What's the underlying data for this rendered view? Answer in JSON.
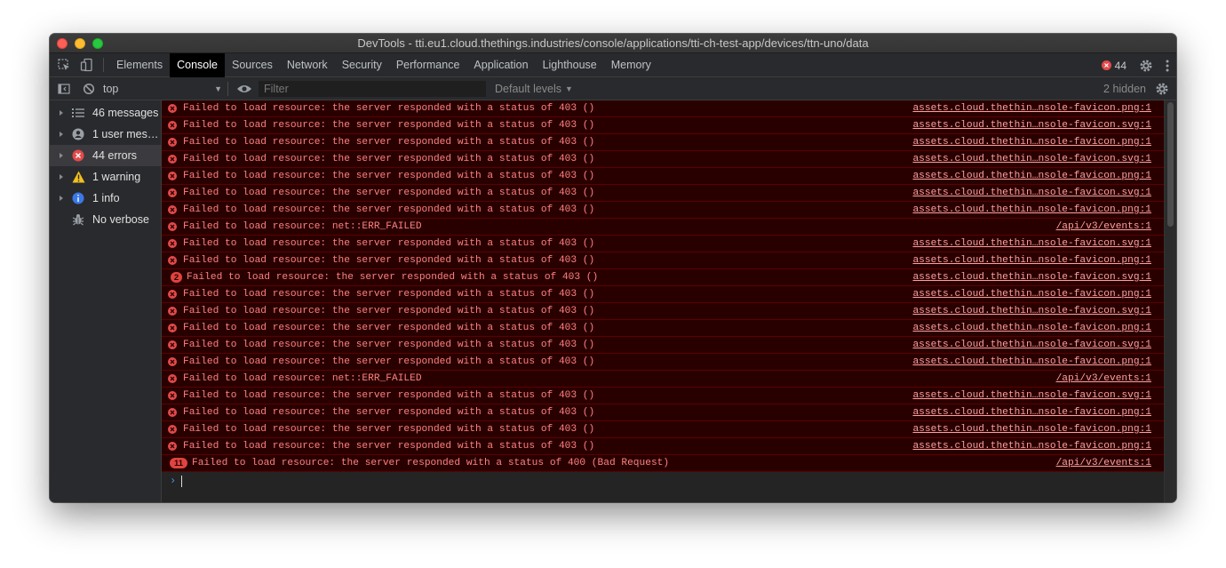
{
  "window": {
    "title": "DevTools - tti.eu1.cloud.thethings.industries/console/applications/tti-ch-test-app/devices/ttn-uno/data"
  },
  "tabs": [
    {
      "label": "Elements",
      "active": false
    },
    {
      "label": "Console",
      "active": true
    },
    {
      "label": "Sources",
      "active": false
    },
    {
      "label": "Network",
      "active": false
    },
    {
      "label": "Security",
      "active": false
    },
    {
      "label": "Performance",
      "active": false
    },
    {
      "label": "Application",
      "active": false
    },
    {
      "label": "Lighthouse",
      "active": false
    },
    {
      "label": "Memory",
      "active": false
    }
  ],
  "error_count": "44",
  "toolbar": {
    "context": "top",
    "filter_placeholder": "Filter",
    "levels": "Default levels",
    "hidden": "2 hidden"
  },
  "sidebar": {
    "items": [
      {
        "label": "46 messages",
        "icon": "list-icon",
        "selected": false,
        "expandable": true
      },
      {
        "label": "1 user mes…",
        "icon": "user-icon",
        "selected": false,
        "expandable": true
      },
      {
        "label": "44 errors",
        "icon": "error-icon",
        "selected": true,
        "expandable": true
      },
      {
        "label": "1 warning",
        "icon": "warning-icon",
        "selected": false,
        "expandable": true
      },
      {
        "label": "1 info",
        "icon": "info-icon",
        "selected": false,
        "expandable": true
      },
      {
        "label": "No verbose",
        "icon": "bug-icon",
        "selected": false,
        "expandable": false
      }
    ]
  },
  "messages": [
    {
      "text": "Failed to load resource: the server responded with a status of 403 ()",
      "source": "assets.cloud.thethin…nsole-favicon.png:1",
      "count": ""
    },
    {
      "text": "Failed to load resource: the server responded with a status of 403 ()",
      "source": "assets.cloud.thethin…nsole-favicon.svg:1",
      "count": ""
    },
    {
      "text": "Failed to load resource: the server responded with a status of 403 ()",
      "source": "assets.cloud.thethin…nsole-favicon.png:1",
      "count": ""
    },
    {
      "text": "Failed to load resource: the server responded with a status of 403 ()",
      "source": "assets.cloud.thethin…nsole-favicon.svg:1",
      "count": ""
    },
    {
      "text": "Failed to load resource: the server responded with a status of 403 ()",
      "source": "assets.cloud.thethin…nsole-favicon.png:1",
      "count": ""
    },
    {
      "text": "Failed to load resource: the server responded with a status of 403 ()",
      "source": "assets.cloud.thethin…nsole-favicon.svg:1",
      "count": ""
    },
    {
      "text": "Failed to load resource: the server responded with a status of 403 ()",
      "source": "assets.cloud.thethin…nsole-favicon.png:1",
      "count": ""
    },
    {
      "text": "Failed to load resource: net::ERR_FAILED",
      "source": "/api/v3/events:1",
      "count": ""
    },
    {
      "text": "Failed to load resource: the server responded with a status of 403 ()",
      "source": "assets.cloud.thethin…nsole-favicon.svg:1",
      "count": ""
    },
    {
      "text": "Failed to load resource: the server responded with a status of 403 ()",
      "source": "assets.cloud.thethin…nsole-favicon.png:1",
      "count": ""
    },
    {
      "text": "Failed to load resource: the server responded with a status of 403 ()",
      "source": "assets.cloud.thethin…nsole-favicon.svg:1",
      "count": "2"
    },
    {
      "text": "Failed to load resource: the server responded with a status of 403 ()",
      "source": "assets.cloud.thethin…nsole-favicon.png:1",
      "count": ""
    },
    {
      "text": "Failed to load resource: the server responded with a status of 403 ()",
      "source": "assets.cloud.thethin…nsole-favicon.svg:1",
      "count": ""
    },
    {
      "text": "Failed to load resource: the server responded with a status of 403 ()",
      "source": "assets.cloud.thethin…nsole-favicon.png:1",
      "count": ""
    },
    {
      "text": "Failed to load resource: the server responded with a status of 403 ()",
      "source": "assets.cloud.thethin…nsole-favicon.svg:1",
      "count": ""
    },
    {
      "text": "Failed to load resource: the server responded with a status of 403 ()",
      "source": "assets.cloud.thethin…nsole-favicon.png:1",
      "count": ""
    },
    {
      "text": "Failed to load resource: net::ERR_FAILED",
      "source": "/api/v3/events:1",
      "count": ""
    },
    {
      "text": "Failed to load resource: the server responded with a status of 403 ()",
      "source": "assets.cloud.thethin…nsole-favicon.svg:1",
      "count": ""
    },
    {
      "text": "Failed to load resource: the server responded with a status of 403 ()",
      "source": "assets.cloud.thethin…nsole-favicon.png:1",
      "count": ""
    },
    {
      "text": "Failed to load resource: the server responded with a status of 403 ()",
      "source": "assets.cloud.thethin…nsole-favicon.png:1",
      "count": ""
    },
    {
      "text": "Failed to load resource: the server responded with a status of 403 ()",
      "source": "assets.cloud.thethin…nsole-favicon.png:1",
      "count": ""
    },
    {
      "text": "Failed to load resource: the server responded with a status of 400 (Bad Request)",
      "source": "/api/v3/events:1",
      "count": "11"
    }
  ],
  "colors": {
    "error_background": "#290000",
    "error_text": "#ff8080",
    "error_icon": "#e34a4a",
    "active_tab": "#000000"
  }
}
